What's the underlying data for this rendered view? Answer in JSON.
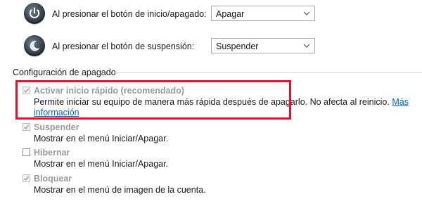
{
  "power_button_row": {
    "label": "Al presionar el botón de inicio/apagado:",
    "selected": "Apagar",
    "icon": "power-button-icon"
  },
  "sleep_button_row": {
    "label": "Al presionar el botón de suspensión:",
    "selected": "Suspender",
    "icon": "sleep-button-icon"
  },
  "shutdown_section": {
    "title": "Configuración de apagado",
    "options": [
      {
        "title": "Activar inicio rápido (recomendado)",
        "checked": true,
        "desc_line1": "Permite iniciar su equipo de manera más rápida después de apagarlo. No afecta al reinicio.",
        "link_part1": "Más",
        "link_part2": "información"
      },
      {
        "title": "Suspender",
        "checked": true,
        "desc": "Mostrar en el menú Iniciar/Apagar."
      },
      {
        "title": "Hibernar",
        "checked": false,
        "desc": "Mostrar en el menú Iniciar/Apagar."
      },
      {
        "title": "Bloquear",
        "checked": true,
        "desc": "Mostrar en el menú de imagen de la cuenta."
      }
    ]
  },
  "colors": {
    "highlight": "#e0142a",
    "link": "#0066cc",
    "disabled_text": "#9a9a9a"
  }
}
